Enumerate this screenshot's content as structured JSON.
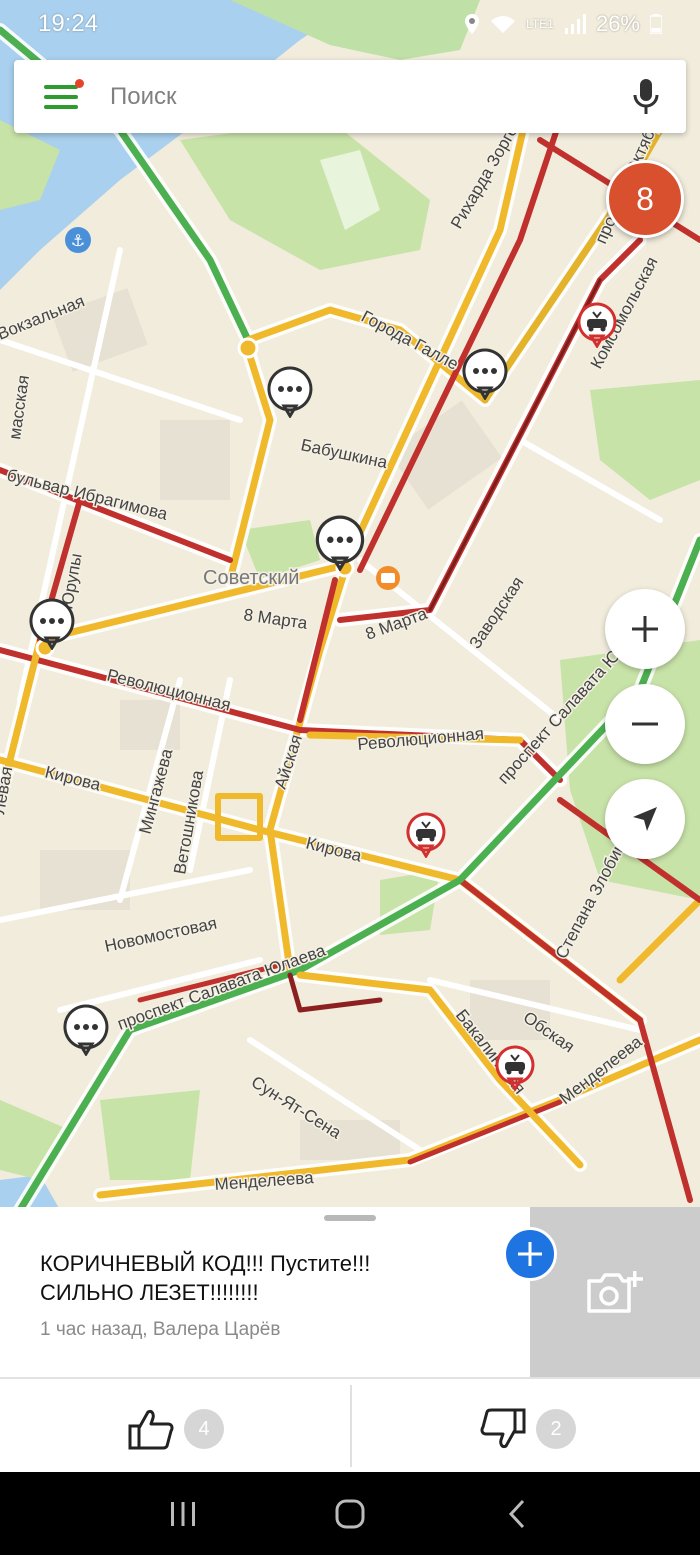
{
  "status_bar": {
    "time": "19:24",
    "battery": "26%",
    "network": "LTE1"
  },
  "search": {
    "placeholder": "Поиск"
  },
  "events_badge": {
    "count": "8"
  },
  "map_labels": [
    {
      "text": "Вокзальная"
    },
    {
      "text": "масская"
    },
    {
      "text": "бульвар Ибрагимова"
    },
    {
      "text": "Рихарда Зорге"
    },
    {
      "text": "Города Галле"
    },
    {
      "text": "Бабушкина"
    },
    {
      "text": "Комсомольская"
    },
    {
      "text": "проспект Октября"
    },
    {
      "text": "Советский"
    },
    {
      "text": "8 Марта"
    },
    {
      "text": "8 Марта"
    },
    {
      "text": "Заводская"
    },
    {
      "text": "Революционная"
    },
    {
      "text": "Революционная"
    },
    {
      "text": "Кирова"
    },
    {
      "text": "Кирова"
    },
    {
      "text": "Мингажева"
    },
    {
      "text": "Ветошникова"
    },
    {
      "text": "Айская"
    },
    {
      "text": "проспект Салавата Юлаева"
    },
    {
      "text": "Новомостовая"
    },
    {
      "text": "проспект Салавата Юлаева"
    },
    {
      "text": "Степана Злобина"
    },
    {
      "text": "Обская"
    },
    {
      "text": "Бакалинская"
    },
    {
      "text": "Сун-Ят-Сена"
    },
    {
      "text": "Менделеева"
    },
    {
      "text": "Менделеева"
    },
    {
      "text": "Юрупы"
    },
    {
      "text": "Левая"
    }
  ],
  "map_controls": {
    "zoom_in": "+",
    "zoom_out": "−"
  },
  "event": {
    "title": "КОРИЧНЕВЫЙ КОД!!! Пустите!!! СИЛЬНО ЛЕЗЕТ!!!!!!!!",
    "meta": "1 час назад, Валера Царёв"
  },
  "votes": {
    "likes": "4",
    "dislikes": "2"
  },
  "colors": {
    "accent": "#1e74e0",
    "badge": "#d9502e",
    "brand_green": "#2e9b2e"
  }
}
